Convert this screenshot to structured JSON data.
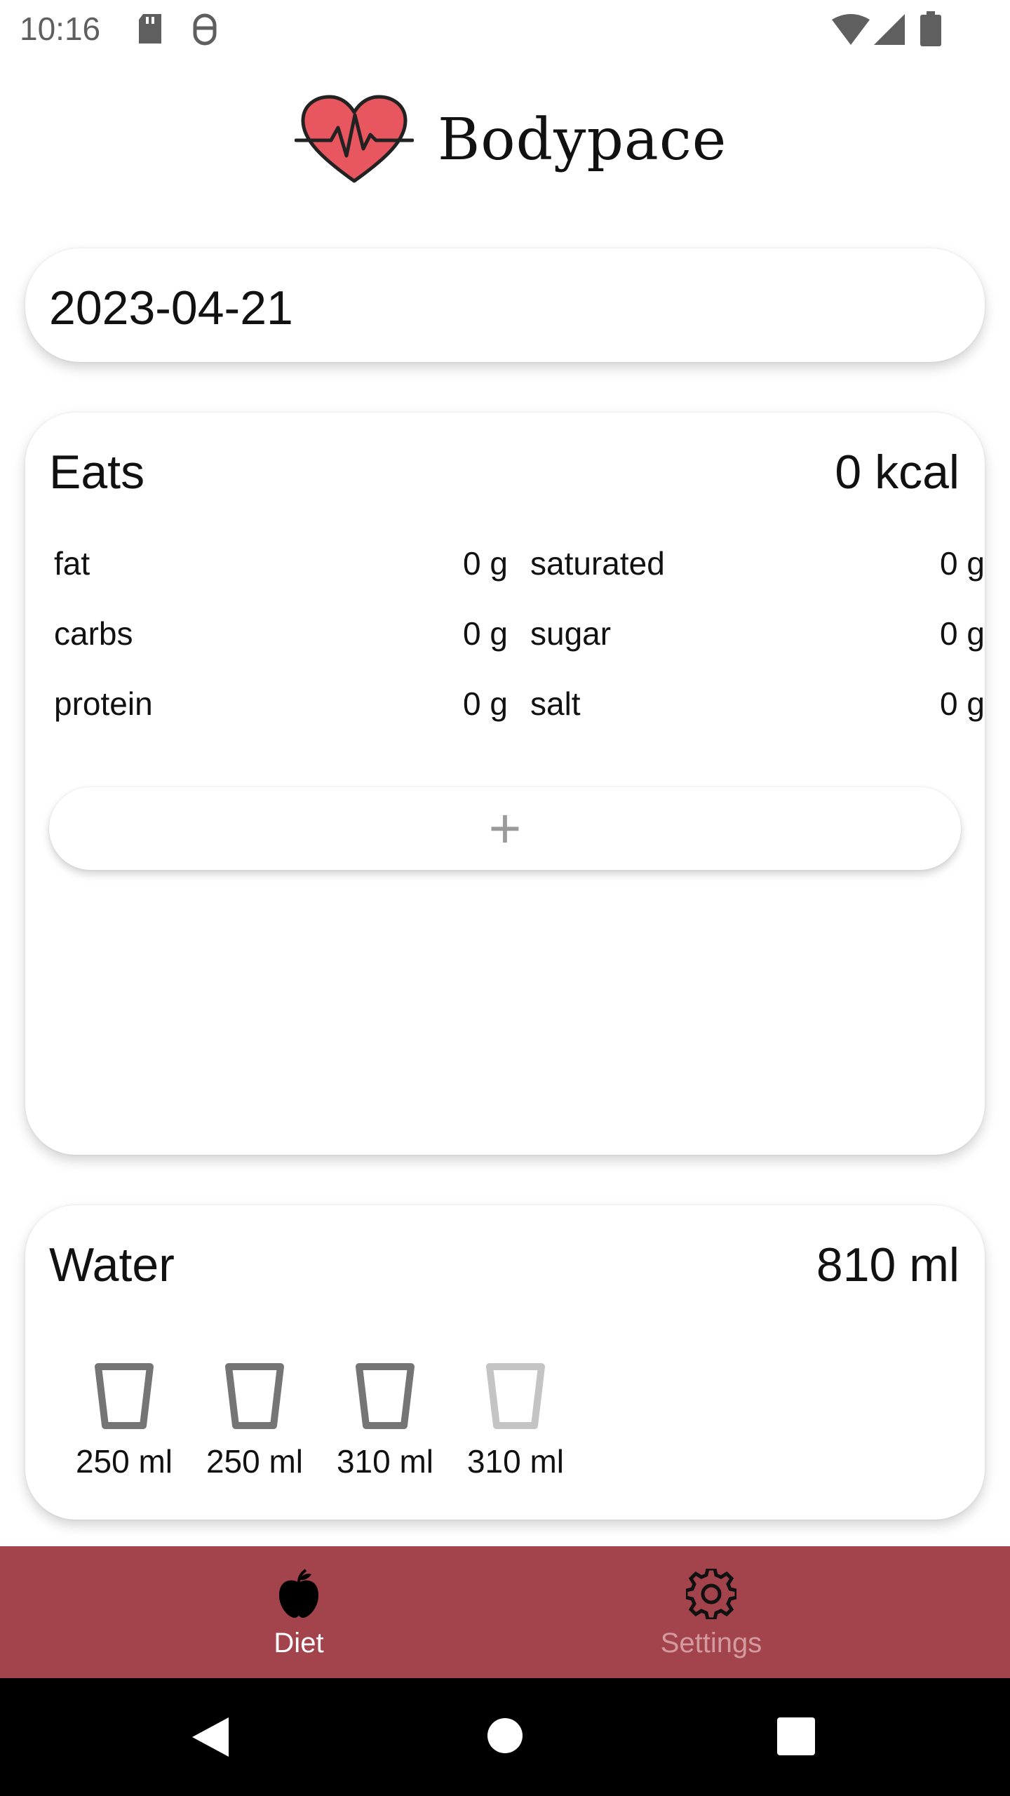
{
  "status_bar": {
    "time": "10:16",
    "left_icons": [
      "sd-card-icon",
      "debug-icon"
    ],
    "right_icons": [
      "wifi-icon",
      "signal-icon",
      "battery-icon"
    ]
  },
  "header": {
    "app_name": "Bodypace",
    "logo_icon": "heart-pulse-icon",
    "logo_color": "#e8565f"
  },
  "date_card": {
    "date": "2023-04-21"
  },
  "eats_card": {
    "title": "Eats",
    "total": "0 kcal",
    "nutrients_left": [
      {
        "label": "fat",
        "value": "0 g"
      },
      {
        "label": "carbs",
        "value": "0 g"
      },
      {
        "label": "protein",
        "value": "0 g"
      }
    ],
    "nutrients_right": [
      {
        "label": "saturated",
        "value": "0 g"
      },
      {
        "label": "sugar",
        "value": "0 g"
      },
      {
        "label": "salt",
        "value": "0 g"
      }
    ],
    "add_label": "+"
  },
  "water_card": {
    "title": "Water",
    "total": "810 ml",
    "glasses": [
      {
        "label": "250 ml",
        "filled": true
      },
      {
        "label": "250 ml",
        "filled": true
      },
      {
        "label": "310 ml",
        "filled": true
      },
      {
        "label": "310 ml",
        "filled": false
      }
    ]
  },
  "bottom_nav": {
    "background": "#a3444d",
    "items": [
      {
        "label": "Diet",
        "icon": "apple-icon",
        "active": true
      },
      {
        "label": "Settings",
        "icon": "gear-icon",
        "active": false
      }
    ]
  },
  "system_nav": {
    "icons": [
      "back-icon",
      "home-icon",
      "recents-icon"
    ]
  }
}
